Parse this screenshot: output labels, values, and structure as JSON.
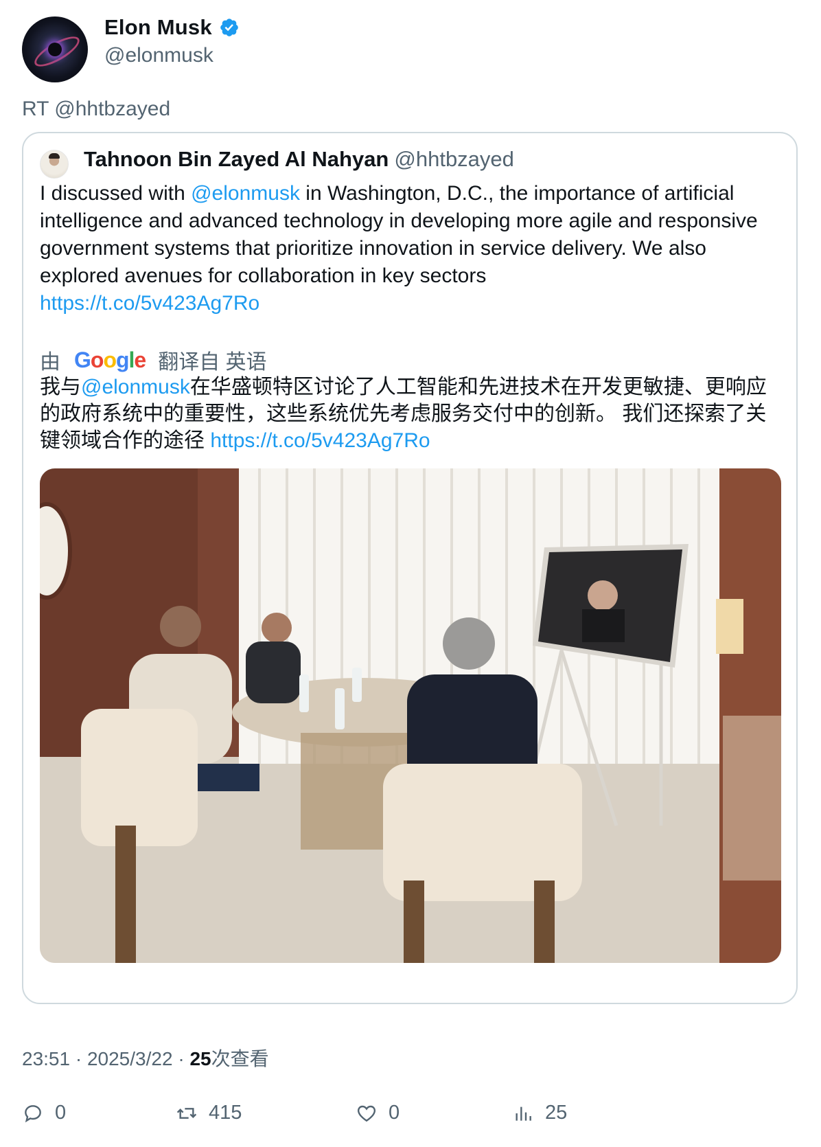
{
  "author": {
    "name": "Elon Musk",
    "handle": "@elonmusk",
    "verified_color": "#1d9bf0"
  },
  "retweet_line": "RT @hhtbzayed",
  "quoted": {
    "name": "Tahnoon Bin Zayed Al Nahyan",
    "handle": "@hhtbzayed",
    "text_part1": "I discussed with ",
    "mention": "@elonmusk",
    "text_part2": "  in Washington, D.C., the importance of artificial intelligence and advanced technology in developing more agile and responsive government systems that prioritize innovation in service delivery. We also explored avenues for collaboration in key sectors",
    "link": "https://t.co/5v423Ag7Ro",
    "translate_prefix": "由",
    "translate_suffix": "翻译自 英语",
    "google_word": [
      "G",
      "o",
      "o",
      "g",
      "l",
      "e"
    ],
    "zh_part1": "我与",
    "zh_mention": "@elonmusk",
    "zh_part2": "在华盛顿特区讨论了人工智能和先进技术在开发更敏捷、更响应的政府系统中的重要性，这些系统优先考虑服务交付中的创新。 我们还探索了关键领域合作的途径 ",
    "zh_link": "https://t.co/5v423Ag7Ro"
  },
  "meta": {
    "time": "23:51",
    "date": "2025/3/22",
    "views": "25",
    "views_suffix": "次查看",
    "separator": "·"
  },
  "actions": {
    "replies": "0",
    "retweets": "415",
    "likes": "0",
    "views": "25"
  },
  "icons": [
    "verified-badge-icon",
    "reply-icon",
    "retweet-icon",
    "like-icon",
    "views-icon"
  ]
}
